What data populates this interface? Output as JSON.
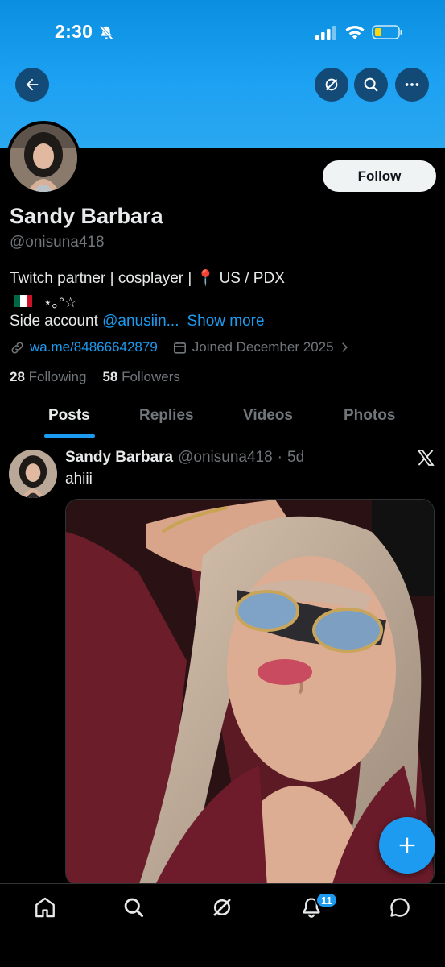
{
  "status_bar": {
    "time": "2:30"
  },
  "profile": {
    "follow_label": "Follow",
    "display_name": "Sandy Barbara",
    "handle": "@onisuna418",
    "bio_line1": "Twitch partner | cosplayer | 📍 US / PDX",
    "bio_line2_deco": "⋆｡°☆",
    "bio_line3_prefix": "Side account ",
    "bio_line3_link": "@anusiin...",
    "show_more": "Show more",
    "website": "wa.me/84866642879",
    "joined": "Joined December 2025",
    "following_count": "28",
    "following_label": "Following",
    "followers_count": "58",
    "followers_label": "Followers"
  },
  "tabs": [
    {
      "label": "Posts",
      "active": true
    },
    {
      "label": "Replies",
      "active": false
    },
    {
      "label": "Videos",
      "active": false
    },
    {
      "label": "Photos",
      "active": false
    }
  ],
  "post": {
    "author_name": "Sandy Barbara",
    "author_handle": "@onisuna418",
    "separator": "·",
    "age": "5d",
    "text": "ahiii"
  },
  "bottom_nav": {
    "items": [
      "home-icon",
      "search-icon",
      "grok-icon",
      "notifications-icon",
      "messages-icon"
    ],
    "notification_badge": "11"
  },
  "colors": {
    "accent": "#1d9bf0",
    "banner": "#1da1f2",
    "background": "#000000",
    "text_secondary": "#71767b"
  }
}
